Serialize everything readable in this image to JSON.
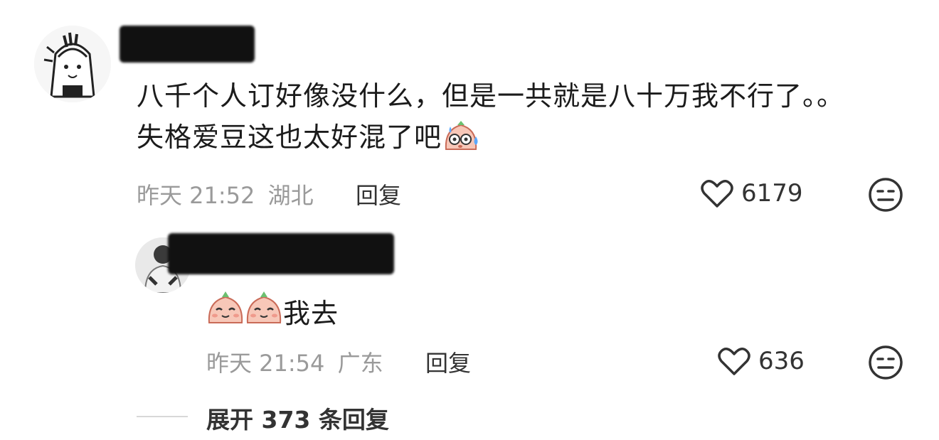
{
  "comments": [
    {
      "username": "",
      "text_line1": "八千个人订好像没什么，但是一共就是八十万我不行了。。",
      "text_line2": "失格爱豆这也太好混了吧",
      "emoji_icon": "sweating-face-emoji",
      "time": "昨天 21:52",
      "location": "湖北",
      "reply_label": "回复",
      "likes": "6179",
      "reaction_icon": "meh-face-icon"
    },
    {
      "username": "",
      "text": "我去",
      "emoji_icons": [
        "smiling-bun-emoji",
        "smiling-bun-emoji"
      ],
      "time": "昨天 21:54",
      "location": "广东",
      "reply_label": "回复",
      "likes": "636",
      "reaction_icon": "meh-face-icon"
    }
  ],
  "expand_label": "展开 373 条回复"
}
